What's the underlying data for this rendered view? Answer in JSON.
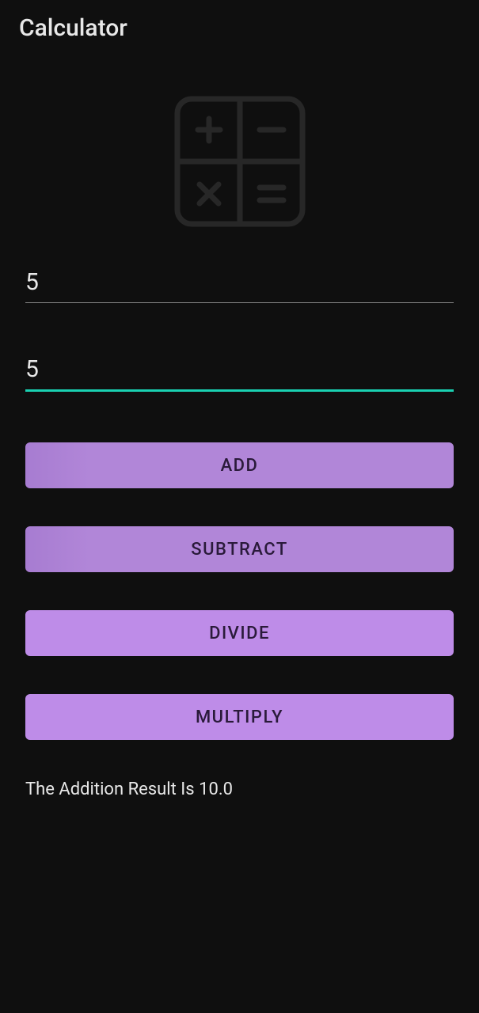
{
  "header": {
    "title": "Calculator"
  },
  "inputs": {
    "first": "5",
    "second": "5"
  },
  "buttons": {
    "add": "ADD",
    "subtract": "SUBTRACT",
    "divide": "DIVIDE",
    "multiply": "MULTIPLY"
  },
  "result": "The Addition Result Is 10.0"
}
